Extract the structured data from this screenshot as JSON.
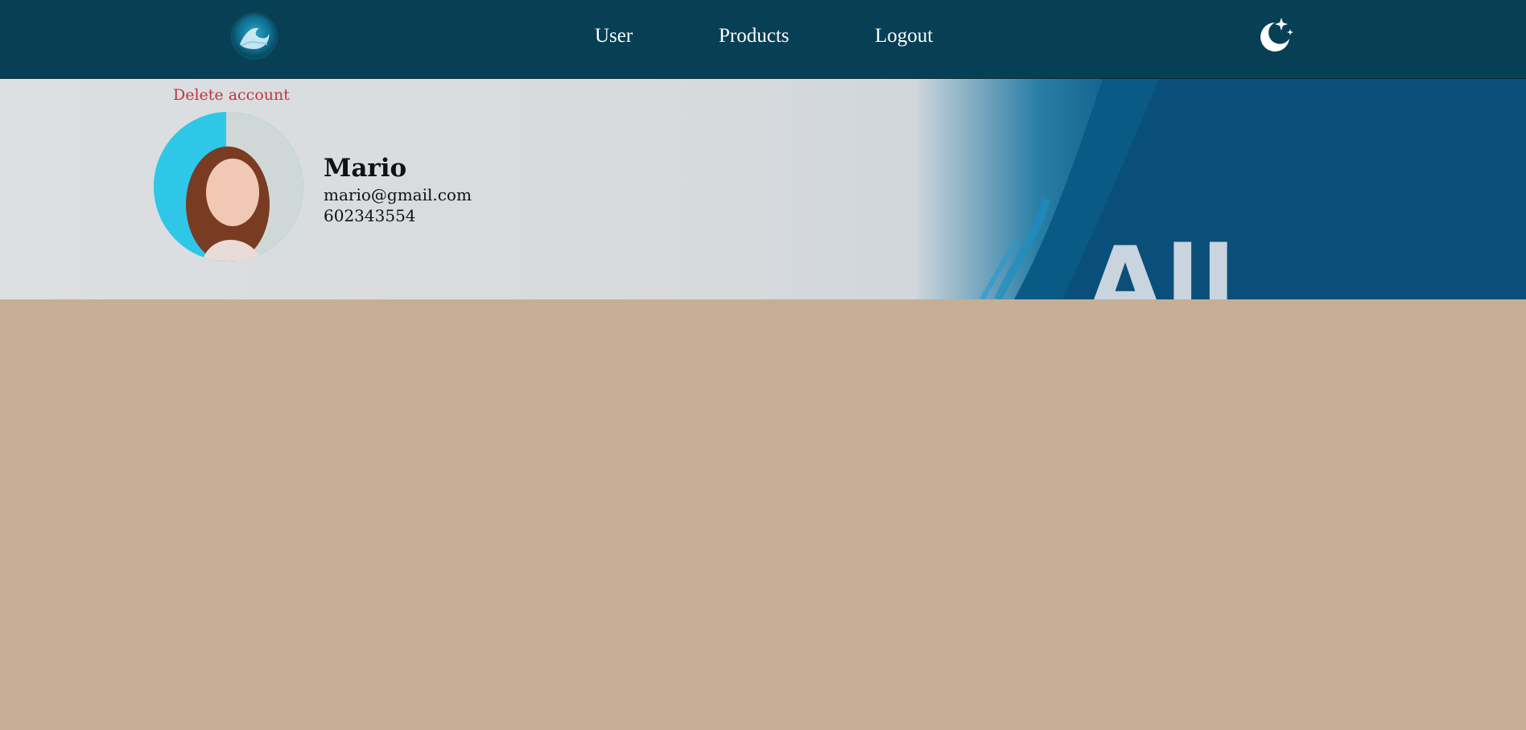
{
  "header": {
    "logo_icon": "wave-logo-icon",
    "nav": [
      {
        "label": "User"
      },
      {
        "label": "Products"
      },
      {
        "label": "Logout"
      }
    ],
    "theme_toggle_icon": "moon-stars-icon"
  },
  "banner": {
    "brand_text": "All Blue"
  },
  "profile": {
    "delete_label": "Delete account",
    "name": "Mario",
    "email": "mario@gmail.com",
    "phone": "602343554"
  },
  "colors": {
    "header_bg": "#073f54",
    "page_bg": "#c6af95",
    "delete_text": "#c0363d"
  }
}
